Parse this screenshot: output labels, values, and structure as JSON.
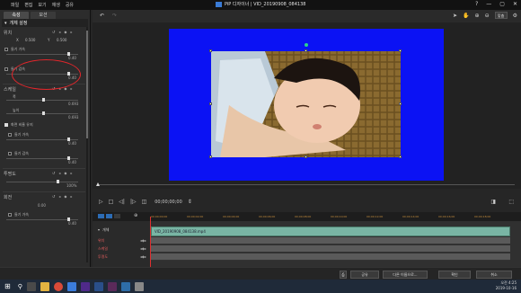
{
  "menu": [
    "파일",
    "편집",
    "보기",
    "재생",
    "공유"
  ],
  "title": "PiP 디자이너 | VID_20190908_084138",
  "window_controls": [
    "?",
    "—",
    "▢",
    "✕"
  ],
  "left_panel": {
    "tabs": [
      "속성",
      "모션"
    ],
    "section_title": "개체 설정",
    "position_label": "위치",
    "pos_x_label": "X",
    "pos_x_value": "0.500",
    "pos_y_label": "Y",
    "pos_y_value": "0.500",
    "ease_in_1": "들기 가속",
    "val_040_a": "0.40",
    "ease_out_1": "들기 감속",
    "val_040_b": "0.40",
    "scale_label": "스케일",
    "width_label": "폭",
    "width_value": "0.693",
    "height_label": "높이",
    "height_value": "0.693",
    "keep_ratio_label": "화면 비율 유지",
    "ease_in_2": "들기 가속",
    "val_040_c": "0.40",
    "ease_out_2": "들기 감속",
    "val_040_d": "0.40",
    "opacity_label": "투명도",
    "opacity_value": "100%",
    "rotation_label": "회전",
    "rotation_value": "0.00",
    "ease_in_3": "들기 가속",
    "val_040_e": "0.40",
    "show_timeline_label": "선택한 트랙만 표시"
  },
  "toolbar": {
    "zoom": "맞춤"
  },
  "playback": {
    "timecode": "00;00;00;00"
  },
  "timeline": {
    "ruler": [
      "00;00;00;00",
      "00;00;02;00",
      "00;00;04;00",
      "00;00;06;00",
      "00;00;08;00",
      "00;00;10;00",
      "00;00;12;00",
      "00;00;14;00",
      "00;00;16;00",
      "00;00;18;00"
    ],
    "track_name": "개체",
    "clip_name": "VID_20190908_084138.mp4",
    "rows": [
      "위치",
      "스케일",
      "투명도"
    ]
  },
  "bottom_buttons": [
    "공유",
    "다른 이름으로...",
    "확인",
    "취소"
  ],
  "clock": {
    "time": "오전 4:25",
    "date": "2019-10-16"
  },
  "colors": {
    "canvas": "#0b12f4",
    "accent": "#2c6cb5",
    "clip": "#79b5a4",
    "highlight": "#e3262b"
  }
}
